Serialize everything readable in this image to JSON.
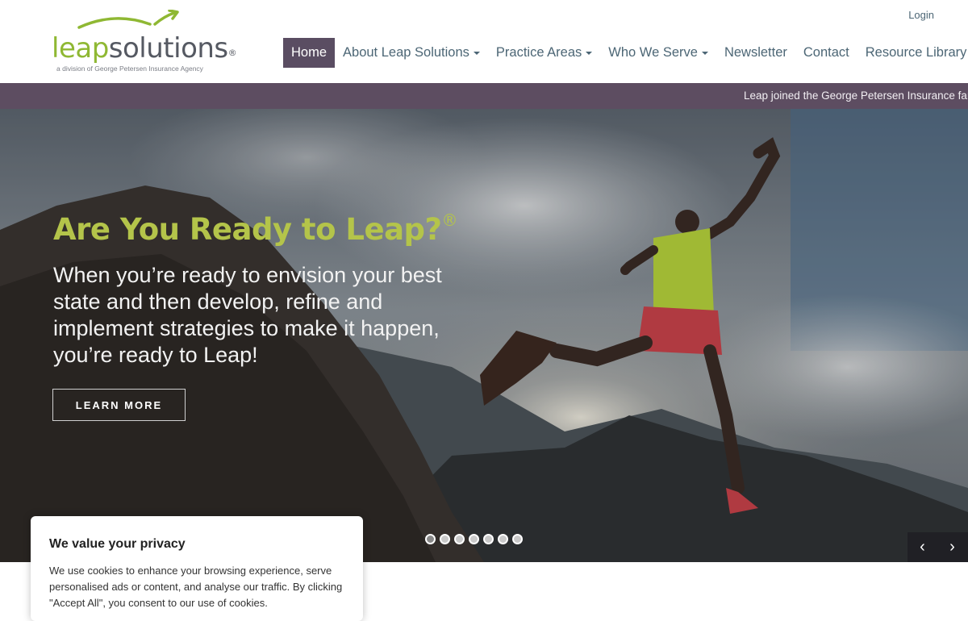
{
  "logo": {
    "leap": "leap",
    "solutions": "solutions",
    "reg": "®",
    "tagline": "a division of George Petersen Insurance Agency",
    "colors": {
      "green": "#8fb833",
      "gray": "#555962"
    }
  },
  "header": {
    "login": "Login"
  },
  "nav": {
    "items": [
      {
        "label": "Home",
        "active": true,
        "dropdown": false
      },
      {
        "label": "About Leap Solutions",
        "dropdown": true
      },
      {
        "label": "Practice Areas",
        "dropdown": true
      },
      {
        "label": "Who We Serve",
        "dropdown": true
      },
      {
        "label": "Newsletter",
        "dropdown": false
      },
      {
        "label": "Contact",
        "dropdown": false
      },
      {
        "label": "Resource Library",
        "dropdown": false
      }
    ],
    "active_color": "#5a4d62"
  },
  "ticker": {
    "text": "Leap joined the George Petersen Insurance fam"
  },
  "hero": {
    "title": "Are You Ready to Leap?",
    "title_reg": "®",
    "subtitle": "When you’re ready to envision your best state and then develop, refine and implement strategies to make it happen, you’re ready to Leap!",
    "button": "LEARN MORE",
    "slides_count": 7,
    "active_slide": 1,
    "prev_icon": "chevron-left-icon",
    "next_icon": "chevron-right-icon",
    "prev_glyph": "‹",
    "next_glyph": "›"
  },
  "cookie": {
    "title": "We value your privacy",
    "body": "We use cookies to enhance your browsing experience, serve personalised ads or content, and analyse our traffic. By clicking \"Accept All\", you consent to our use of cookies."
  }
}
